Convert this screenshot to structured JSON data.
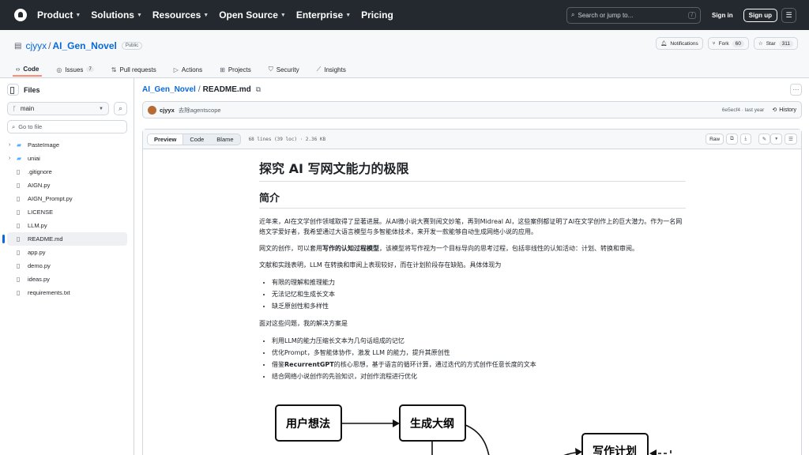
{
  "header": {
    "nav": [
      {
        "label": "Product"
      },
      {
        "label": "Solutions"
      },
      {
        "label": "Resources"
      },
      {
        "label": "Open Source"
      },
      {
        "label": "Enterprise"
      },
      {
        "label": "Pricing"
      }
    ],
    "search_placeholder": "Search or jump to...",
    "search_key": "/",
    "sign_in": "Sign in",
    "sign_up": "Sign up"
  },
  "repo": {
    "owner": "cjyyx",
    "name": "AI_Gen_Novel",
    "visibility": "Public",
    "notifications": "Notifications",
    "fork_label": "Fork",
    "fork_count": "60",
    "star_label": "Star",
    "star_count": "311"
  },
  "tabs": [
    {
      "label": "Code"
    },
    {
      "label": "Issues",
      "count": "7"
    },
    {
      "label": "Pull requests"
    },
    {
      "label": "Actions"
    },
    {
      "label": "Projects"
    },
    {
      "label": "Security"
    },
    {
      "label": "Insights"
    }
  ],
  "sidebar": {
    "title": "Files",
    "branch": "main",
    "goto_placeholder": "Go to file",
    "tree": [
      {
        "name": "PasteImage",
        "type": "dir"
      },
      {
        "name": "uniai",
        "type": "dir"
      },
      {
        "name": ".gitignore",
        "type": "file"
      },
      {
        "name": "AIGN.py",
        "type": "file"
      },
      {
        "name": "AIGN_Prompt.py",
        "type": "file"
      },
      {
        "name": "LICENSE",
        "type": "file"
      },
      {
        "name": "LLM.py",
        "type": "file"
      },
      {
        "name": "README.md",
        "type": "file",
        "selected": true
      },
      {
        "name": "app.py",
        "type": "file"
      },
      {
        "name": "demo.py",
        "type": "file"
      },
      {
        "name": "ideas.py",
        "type": "file"
      },
      {
        "name": "requirements.txt",
        "type": "file"
      }
    ]
  },
  "breadcrumb": {
    "repo": "AI_Gen_Novel",
    "file": "README.md"
  },
  "commit": {
    "author": "cjyyx",
    "message": "去除agentscope",
    "sha_time": "6e5ecf4 · last year",
    "history": "History"
  },
  "fileview": {
    "tabs": {
      "preview": "Preview",
      "code": "Code",
      "blame": "Blame"
    },
    "meta": "68 lines (39 loc) · 2.36 KB",
    "raw": "Raw"
  },
  "readme": {
    "h1": "探究 AI 写网文能力的极限",
    "h2": "简介",
    "p1": "近年来，AI在文学创作领域取得了显著进展。从AI微小说大赛到阅文妙笔，再到Midreal AI，这些案例都证明了AI在文学创作上的巨大潜力。作为一名网络文学爱好者，我希望通过大语言模型与多智能体技术，来开发一款能够自动生成网络小说的应用。",
    "p2_pre": "网文的创作，可以套用",
    "p2_bold": "写作的认知过程模型",
    "p2_post": "，该模型将写作视为一个目标导向的思考过程，包括非线性的认知活动：计划、转换和审阅。",
    "p3": "文献和实践表明，LLM 在转换和审阅上表现较好，而在计划阶段存在缺陷。具体体现为",
    "list1": [
      "有限的理解和推理能力",
      "无法记忆和生成长文本",
      "缺乏原创性和多样性"
    ],
    "p4": "面对这些问题，我的解决方案是",
    "list2_a": "利用LLM的能力压缩长文本为几句话组成的记忆",
    "list2_b": "优化Prompt，多智能体协作，激发 LLM 的能力，提升其原创性",
    "list2_c_pre": "借鉴",
    "list2_c_bold": "RecurrentGPT",
    "list2_c_post": "的核心思想，基于语言的循环计算，通过迭代的方式创作任意长度的文本",
    "list2_d": "结合网络小说创作的先验知识，对创作流程进行优化",
    "diagram": {
      "box1": "用户想法",
      "box2": "生成大纲",
      "box3": "写作计划"
    }
  }
}
